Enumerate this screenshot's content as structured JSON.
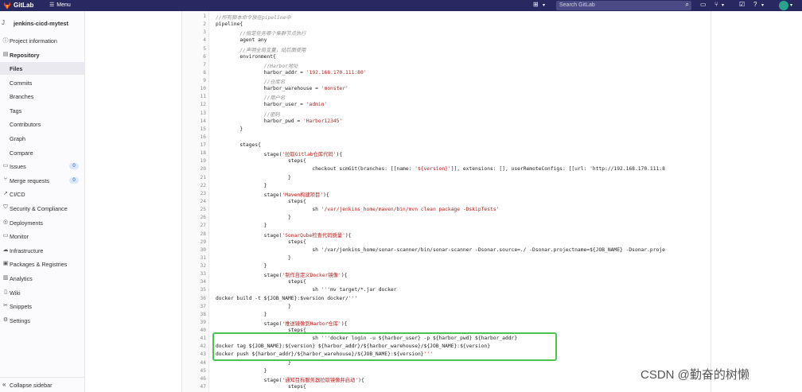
{
  "topbar": {
    "brand": "GitLab",
    "menu_label": "Menu",
    "search_placeholder": "Search GitLab"
  },
  "sidebar": {
    "project_avatar_letter": "J",
    "project_name": "jenkins-cicd-mytest",
    "items": [
      {
        "label": "Project information",
        "icon": "info-icon"
      },
      {
        "label": "Repository",
        "icon": "repo-icon"
      },
      {
        "label": "Files"
      },
      {
        "label": "Commits"
      },
      {
        "label": "Branches"
      },
      {
        "label": "Tags"
      },
      {
        "label": "Contributors"
      },
      {
        "label": "Graph"
      },
      {
        "label": "Compare"
      },
      {
        "label": "Issues",
        "icon": "issues-icon",
        "badge": "0"
      },
      {
        "label": "Merge requests",
        "icon": "merge-request-icon",
        "badge": "0"
      },
      {
        "label": "CI/CD",
        "icon": "rocket-icon"
      },
      {
        "label": "Security & Compliance",
        "icon": "shield-icon"
      },
      {
        "label": "Deployments",
        "icon": "deploy-icon"
      },
      {
        "label": "Monitor",
        "icon": "monitor-icon"
      },
      {
        "label": "Infrastructure",
        "icon": "cloud-icon"
      },
      {
        "label": "Packages & Registries",
        "icon": "package-icon"
      },
      {
        "label": "Analytics",
        "icon": "chart-icon"
      },
      {
        "label": "Wiki",
        "icon": "book-icon"
      },
      {
        "label": "Snippets",
        "icon": "scissors-icon"
      },
      {
        "label": "Settings",
        "icon": "gear-icon"
      }
    ],
    "collapse_label": "Collapse sidebar"
  },
  "code": {
    "line_numbers": [
      "1",
      "2",
      "3",
      "4",
      "5",
      "6",
      "7",
      "8",
      "9",
      "10",
      "11",
      "12",
      "13",
      "14",
      "15",
      "16",
      "17",
      "18",
      "19",
      "20",
      "21",
      "22",
      "23",
      "24",
      "25",
      "26",
      "27",
      "28",
      "29",
      "30",
      "31",
      "32",
      "33",
      "34",
      "35",
      "36",
      "37",
      "38",
      "39",
      "40",
      "41",
      "42",
      "43",
      "44",
      "45",
      "46",
      "47"
    ],
    "lines": [
      "//所有脚本命令放在pipeline中",
      "pipeline{",
      "        //指定任务哪个集群节点执行",
      "        agent any",
      "        //声明全局变量，站后面使用",
      "        environment{",
      "                //Harbor地址",
      "                harbor_addr = '192.168.170.111:80'",
      "                //仓库名",
      "                harbor_warehouse = 'monster'",
      "                //用户名",
      "                harbor_user = 'admin'",
      "                //密码",
      "                harbor_pwd = 'Harbor12345'",
      "        }",
      "",
      "        stages{",
      "                stage('拉取Gitlab仓库代码'){",
      "                        steps{",
      "                                checkout scmGit(branches: [[name: '${version}']], extensions: [], userRemoteConfigs: [[url: 'http://192.168.170.111:8",
      "                        }",
      "                }",
      "                stage('Maven构建项目'){",
      "                        steps{",
      "                                sh '/var/jenkins_home/maven/bin/mvn clean package -DskipTests'",
      "                        }",
      "                }",
      "                stage('SonarQube检查代码质量'){",
      "                        steps{",
      "                                sh '/var/jenkins_home/sonar-scanner/bin/sonar-scanner -Dsonar.source=./ -Dsonar.projectname=${JOB_NAME} -Dsonar.proje",
      "                        }",
      "                }",
      "                stage('制作自定义Docker镜像'){",
      "                        steps{",
      "                                sh '''mv target/*.jar docker",
      "docker build -t ${JOB_NAME}:$version docker/'''",
      "                        }",
      "                }",
      "                stage('推送镜像到Harbor仓库'){",
      "                        steps{",
      "                                sh '''docker login -u ${harbor_user} -p ${harbor_pwd} ${harbor_addr}",
      "docker tag ${JOB_NAME}:${version} ${harbor_addr}/${harbor_warehouse}/${JOB_NAME}:${version}",
      "docker push ${harbor_addr}/${harbor_warehouse}/${JOB_NAME}:${version}'''",
      "                        }",
      "                }",
      "                stage('通知目标服务器拉取镜像并启动'){",
      "                        steps{"
    ]
  },
  "watermark": "CSDN @勤奋的树懒"
}
